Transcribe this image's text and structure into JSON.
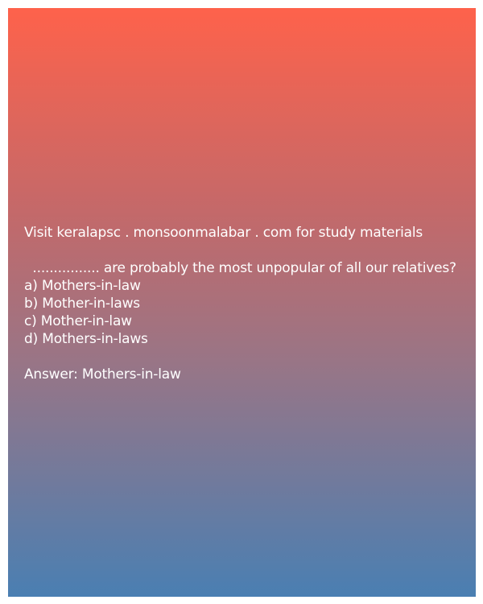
{
  "promo_text": "Visit keralapsc . monsoonmalabar . com for study materials",
  "question": "  ................ are probably the most unpopular of all our relatives?",
  "options": [
    "a) Mothers-in-law",
    "b) Mother-in-laws",
    "c) Mother-in-law",
    "d) Mothers-in-laws"
  ],
  "answer": "Answer: Mothers-in-law",
  "colors": {
    "gradient_top": "#fe624b",
    "gradient_bottom": "#4a7fb2",
    "text": "#ffffff"
  }
}
